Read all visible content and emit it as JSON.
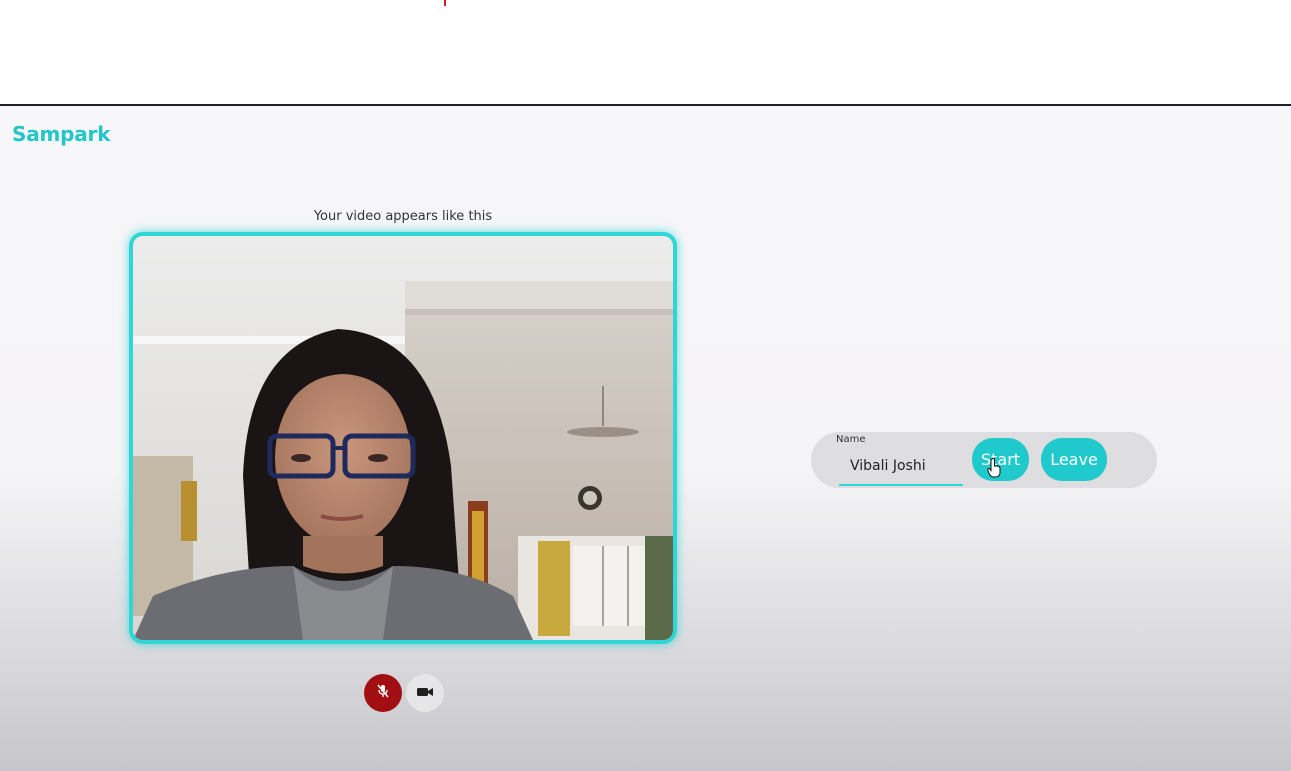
{
  "app": {
    "brand": "Sampark"
  },
  "preview": {
    "caption": "Your video appears like this"
  },
  "controls": {
    "mic_icon": "mic-off-icon",
    "camera_icon": "video-camera-icon",
    "mic_state": "muted"
  },
  "join": {
    "name_label": "Name",
    "name_value": "Vibali Joshi",
    "start_label": "Start",
    "leave_label": "Leave"
  },
  "colors": {
    "accent": "#20c9cb",
    "brand": "#22c6c8",
    "mic_muted": "#a10f12",
    "frame_border": "#2fd6d5"
  }
}
